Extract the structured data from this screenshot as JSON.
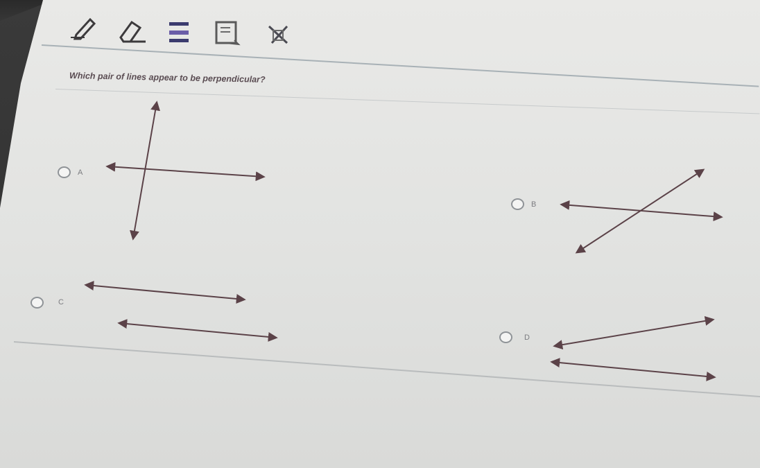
{
  "toolbar": {
    "tools": [
      {
        "name": "pencil-icon"
      },
      {
        "name": "eraser-icon"
      },
      {
        "name": "highlighter-icon"
      },
      {
        "name": "notepad-icon"
      },
      {
        "name": "cross-out-icon"
      }
    ]
  },
  "question": {
    "text": "Which pair of lines appear to be perpendicular?"
  },
  "choices": [
    {
      "id": "A",
      "label": "A"
    },
    {
      "id": "B",
      "label": "B"
    },
    {
      "id": "C",
      "label": "C"
    },
    {
      "id": "D",
      "label": "D"
    }
  ],
  "colors": {
    "line": "#5b4248",
    "accent": "#2f3b8c"
  }
}
